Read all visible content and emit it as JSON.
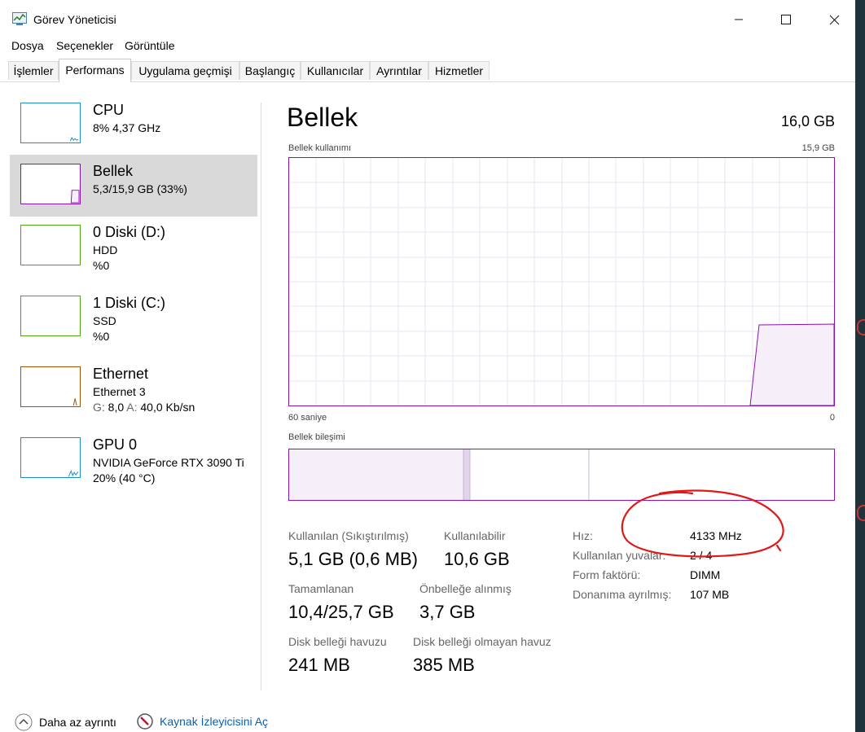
{
  "window": {
    "title": "Görev Yöneticisi"
  },
  "menu": [
    "Dosya",
    "Seçenekler",
    "Görüntüle"
  ],
  "tabs": [
    "İşlemler",
    "Performans",
    "Uygulama geçmişi",
    "Başlangıç",
    "Kullanıcılar",
    "Ayrıntılar",
    "Hizmetler"
  ],
  "active_tab": "Performans",
  "sidebar": {
    "items": [
      {
        "name": "CPU",
        "line2": "8% 4,37 GHz",
        "line3": "",
        "color": "#1a8fc9",
        "selected": false
      },
      {
        "name": "Bellek",
        "line2": "5,3/15,9 GB (33%)",
        "line3": "",
        "color": "#8b12ae",
        "selected": true
      },
      {
        "name": "0 Diski (D:)",
        "line2": "HDD",
        "line3": "%0",
        "color": "#4da60c",
        "selected": false
      },
      {
        "name": "1 Diski (C:)",
        "line2": "SSD",
        "line3": "%0",
        "color": "#4da60c",
        "selected": false
      },
      {
        "name": "Ethernet",
        "line2": "Ethernet 3",
        "line3": "",
        "color": "#a74f01",
        "selected": false
      },
      {
        "name": "GPU 0",
        "line2": "NVIDIA GeForce RTX 3090 Ti",
        "line3": "20% (40 °C)",
        "color": "#1a8fc9",
        "selected": false
      }
    ],
    "ethernet_send_label": "G:",
    "ethernet_send_value": "8,0",
    "ethernet_recv_label": "A:",
    "ethernet_recv_value": "40,0 Kb/sn"
  },
  "main": {
    "title": "Bellek",
    "total": "16,0 GB",
    "usage_label": "Bellek kullanımı",
    "usage_max": "15,9 GB",
    "time_left": "60 saniye",
    "time_right": "0",
    "composition_label": "Bellek bileşimi",
    "accent": "#8b12ae",
    "stats": [
      {
        "label": "Kullanılan (Sıkıştırılmış)",
        "value": "5,1 GB (0,6 MB)"
      },
      {
        "label": "Kullanılabilir",
        "value": "10,6 GB"
      },
      {
        "label": "Tamamlanan",
        "value": "10,4/25,7 GB"
      },
      {
        "label": "Önbelleğe alınmış",
        "value": "3,7 GB"
      },
      {
        "label": "Disk belleği havuzu",
        "value": "241 MB"
      },
      {
        "label": "Disk belleği olmayan havuz",
        "value": "385 MB"
      }
    ],
    "props": [
      {
        "label": "Hız:",
        "value": "4133 MHz"
      },
      {
        "label": "Kullanılan yuvalar:",
        "value": "2 / 4"
      },
      {
        "label": "Form faktörü:",
        "value": "DIMM"
      },
      {
        "label": "Donanıma ayrılmış:",
        "value": "107 MB"
      }
    ]
  },
  "footer": {
    "fewer_details": "Daha az ayrıntı",
    "resource_monitor": "Kaynak İzleyicisini Aç"
  }
}
